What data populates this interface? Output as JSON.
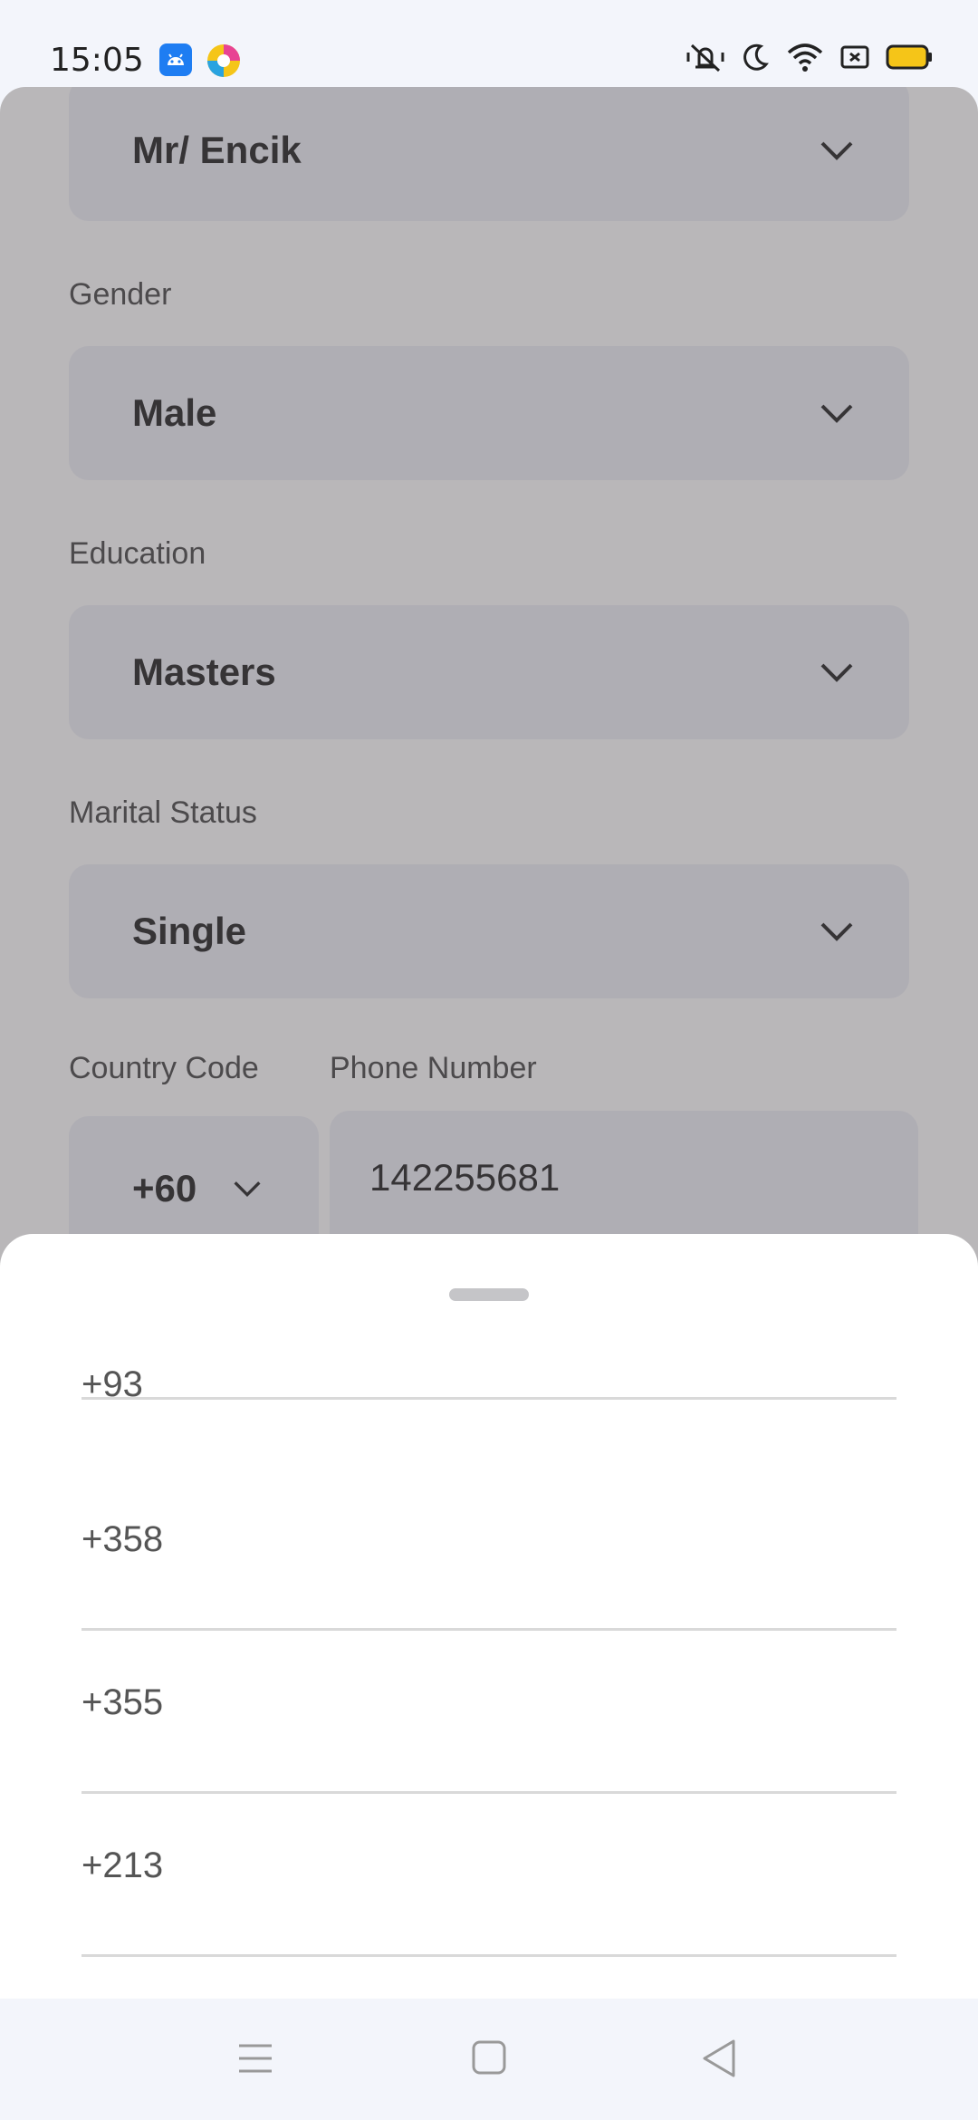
{
  "status_bar": {
    "time": "15:05",
    "icons": [
      "android-app-icon",
      "browser-app-icon",
      "vibrate-icon",
      "moon-icon",
      "wifi-icon",
      "battery-saver-icon",
      "battery-icon"
    ]
  },
  "form": {
    "title_select": {
      "value": "Mr/ Encik"
    },
    "gender": {
      "label": "Gender",
      "value": "Male"
    },
    "education": {
      "label": "Education",
      "value": "Masters"
    },
    "marital_status": {
      "label": "Marital Status",
      "value": "Single"
    },
    "country_code": {
      "label": "Country Code",
      "value": "+60"
    },
    "phone_number": {
      "label": "Phone Number",
      "value": "142255681"
    }
  },
  "sheet": {
    "options": [
      "+93",
      "+358",
      "+355",
      "+213"
    ]
  },
  "navbar": {
    "icons": [
      "menu-icon",
      "home-icon",
      "back-icon"
    ]
  }
}
